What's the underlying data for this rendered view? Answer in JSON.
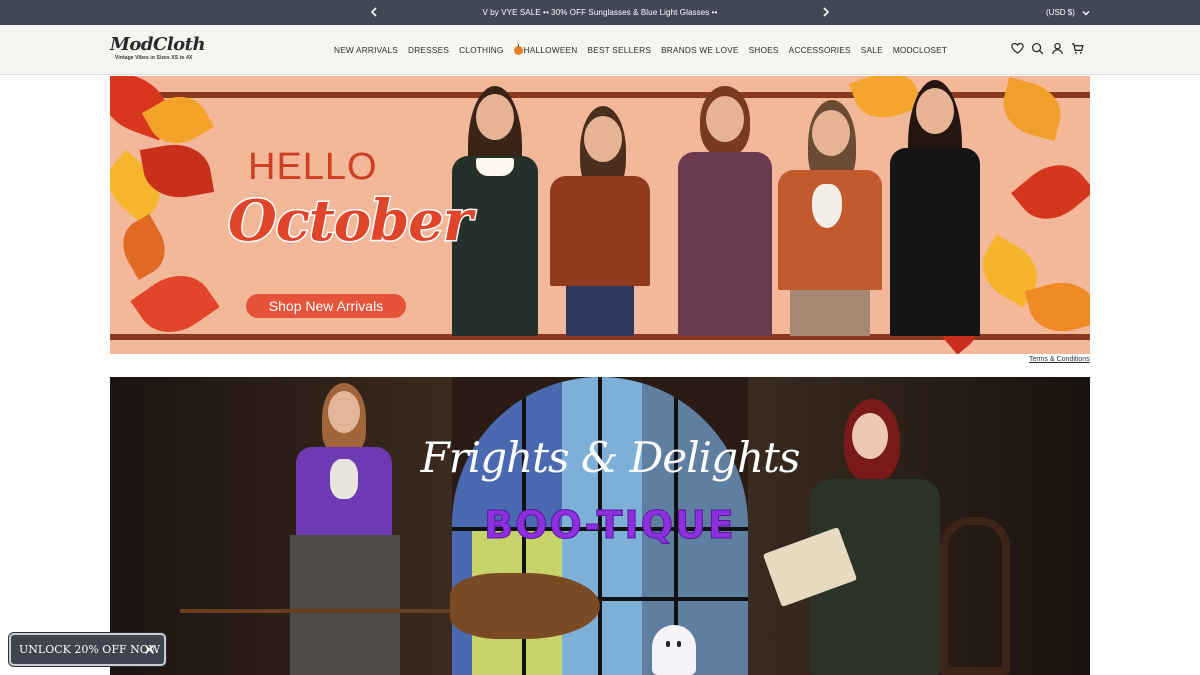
{
  "announcement": {
    "message": "V by VYE SALE •• 30% OFF Sunglasses & Blue Light Glasses ••",
    "currency": "(USD $)"
  },
  "header": {
    "logo_text": "ModCloth",
    "tagline": "Vintage Vibes in Sizes XS to 4X",
    "nav": [
      "NEW ARRIVALS",
      "DRESSES",
      "CLOTHING",
      "HALLOWEEN",
      "BEST SELLERS",
      "BRANDS WE LOVE",
      "SHOES",
      "ACCESSORIES",
      "SALE",
      "MODCLOSET"
    ],
    "icons": [
      "heart-icon",
      "search-icon",
      "account-icon",
      "cart-icon"
    ]
  },
  "hero": {
    "hello": "HELLO",
    "october": "October",
    "cta": "Shop New Arrivals",
    "terms": "Terms & Conditions"
  },
  "banner2": {
    "title": "Frights & Delights",
    "subtitle": "BOO-TIQUE"
  },
  "promo": {
    "label": "UNLOCK 20% OFF NOW"
  },
  "colors": {
    "announcement_bg": "#414757",
    "header_bg": "#f7f5f1",
    "hero_bg": "#f3b79a",
    "cta_bg": "#e5533a",
    "boo_purple": "#8e2fe0",
    "promo_bg": "#3f4450"
  }
}
